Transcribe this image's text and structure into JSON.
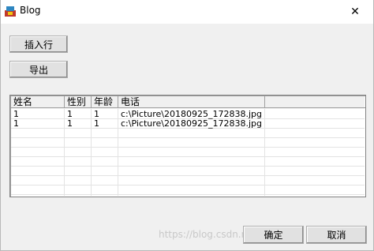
{
  "window": {
    "title": "Blog",
    "close_glyph": "✕"
  },
  "buttons": {
    "insert_row": "插入行",
    "export": "导出",
    "ok": "确定",
    "cancel": "取消"
  },
  "table": {
    "columns": [
      "姓名",
      "性别",
      "年龄",
      "电话"
    ],
    "rows": [
      [
        "1",
        "1",
        "1",
        "c:\\Picture\\20180925_172838.jpg"
      ],
      [
        "1",
        "1",
        "1",
        "c:\\Picture\\20180925_172838.jpg"
      ]
    ]
  },
  "watermark": "https://blog.csdn.net/u0...",
  "colors": {
    "window_bg": "#f0f0f0",
    "titlebar_bg": "#ffffff",
    "button_bg": "#e1e1e1"
  },
  "icons": {
    "app": "app-icon",
    "close": "close-icon"
  }
}
